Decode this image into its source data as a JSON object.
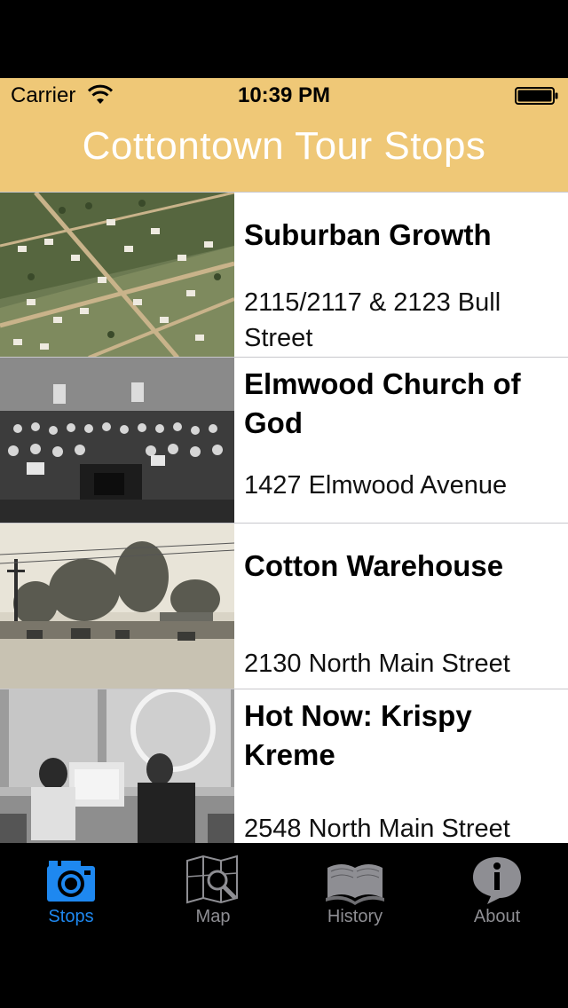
{
  "status_bar": {
    "carrier": "Carrier",
    "time": "10:39 PM"
  },
  "nav": {
    "title": "Cottontown Tour Stops"
  },
  "stops": [
    {
      "title": "Suburban Growth",
      "address": "2115/2117 & 2123 Bull Street",
      "image": "aerial-town-photo"
    },
    {
      "title": "Elmwood Church of God",
      "address": "1427 Elmwood Avenue",
      "image": "church-congregation-photo"
    },
    {
      "title": "Cotton Warehouse",
      "address": "2130 North Main Street",
      "image": "street-scene-photo"
    },
    {
      "title": "Hot Now: Krispy Kreme",
      "address": "2548 North Main Street",
      "image": "diner-photo"
    }
  ],
  "tabs": [
    {
      "label": "Stops",
      "icon": "camera-icon",
      "active": true
    },
    {
      "label": "Map",
      "icon": "map-icon",
      "active": false
    },
    {
      "label": "History",
      "icon": "book-icon",
      "active": false
    },
    {
      "label": "About",
      "icon": "info-icon",
      "active": false
    }
  ],
  "colors": {
    "header": "#efc877",
    "tab_active": "#1e88f0",
    "tab_inactive": "#8e8e93"
  }
}
